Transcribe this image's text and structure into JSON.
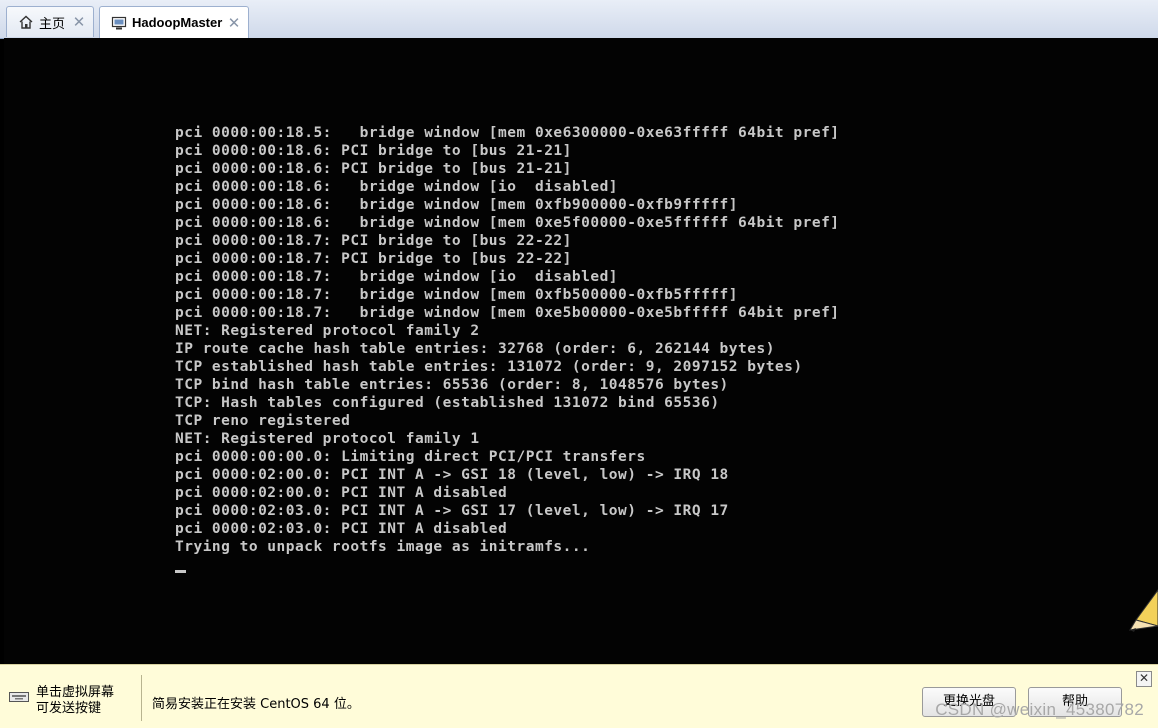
{
  "tabs": [
    {
      "label": "主页",
      "icon": "home-icon",
      "active": false
    },
    {
      "label": "HadoopMaster",
      "icon": "vm-icon",
      "active": true
    }
  ],
  "console": {
    "lines": [
      "pci 0000:00:18.5:   bridge window [mem 0xe6300000-0xe63fffff 64bit pref]",
      "pci 0000:00:18.6: PCI bridge to [bus 21-21]",
      "pci 0000:00:18.6: PCI bridge to [bus 21-21]",
      "pci 0000:00:18.6:   bridge window [io  disabled]",
      "pci 0000:00:18.6:   bridge window [mem 0xfb900000-0xfb9fffff]",
      "pci 0000:00:18.6:   bridge window [mem 0xe5f00000-0xe5ffffff 64bit pref]",
      "pci 0000:00:18.7: PCI bridge to [bus 22-22]",
      "pci 0000:00:18.7: PCI bridge to [bus 22-22]",
      "pci 0000:00:18.7:   bridge window [io  disabled]",
      "pci 0000:00:18.7:   bridge window [mem 0xfb500000-0xfb5fffff]",
      "pci 0000:00:18.7:   bridge window [mem 0xe5b00000-0xe5bfffff 64bit pref]",
      "NET: Registered protocol family 2",
      "IP route cache hash table entries: 32768 (order: 6, 262144 bytes)",
      "TCP established hash table entries: 131072 (order: 9, 2097152 bytes)",
      "TCP bind hash table entries: 65536 (order: 8, 1048576 bytes)",
      "TCP: Hash tables configured (established 131072 bind 65536)",
      "TCP reno registered",
      "NET: Registered protocol family 1",
      "pci 0000:00:00.0: Limiting direct PCI/PCI transfers",
      "pci 0000:02:00.0: PCI INT A -> GSI 18 (level, low) -> IRQ 18",
      "pci 0000:02:00.0: PCI INT A disabled",
      "pci 0000:02:03.0: PCI INT A -> GSI 17 (level, low) -> IRQ 17",
      "pci 0000:02:03.0: PCI INT A disabled",
      "Trying to unpack rootfs image as initramfs..."
    ]
  },
  "notification_bar": {
    "hint_line1": "单击虚拟屏幕",
    "hint_line2": "可发送按键",
    "message": "简易安装正在安装 CentOS 64 位。",
    "change_disc_button": "更换光盘",
    "help_button": "帮助",
    "close_symbol": "✕"
  },
  "watermark": "CSDN @weixin_45380782",
  "colors": {
    "console_text": "#c8c8c8",
    "console_bg": "#030303",
    "bar_bg": "#fffcd9"
  }
}
